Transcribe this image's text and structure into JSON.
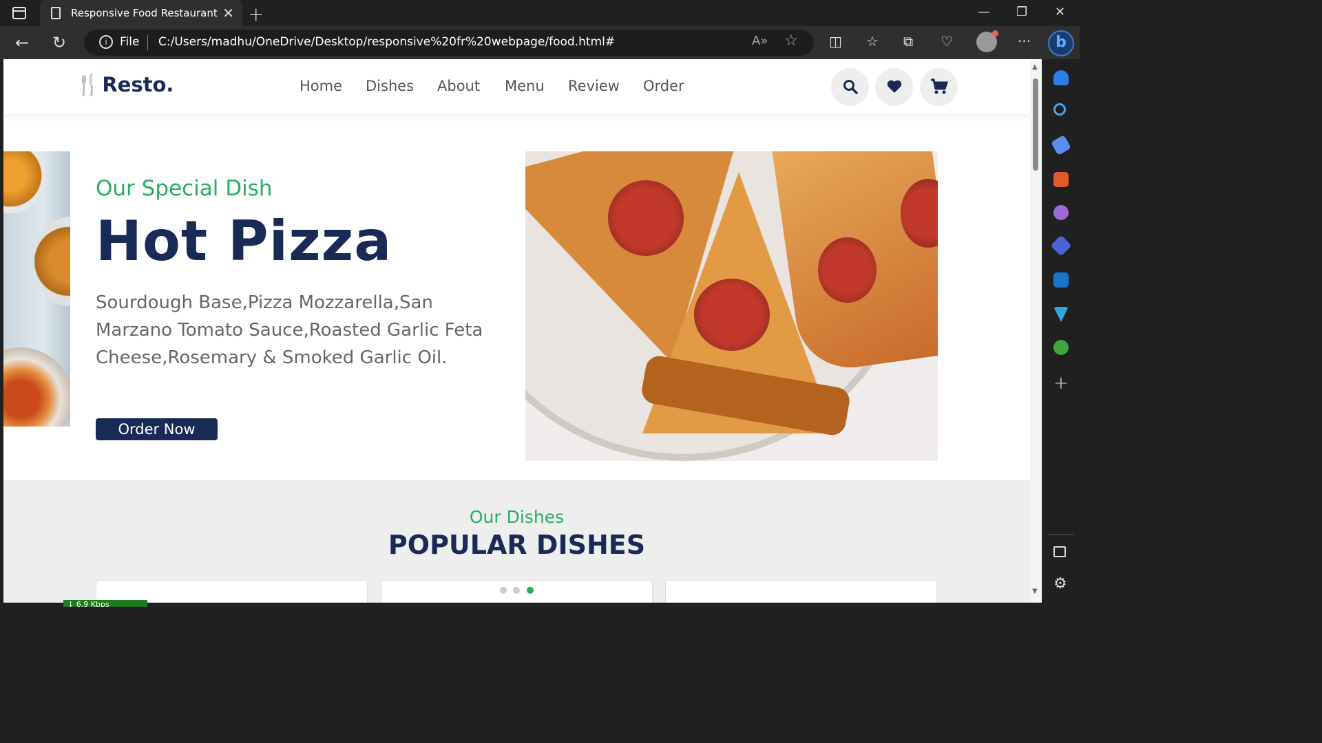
{
  "browser": {
    "tab_title": "Responsive Food Restaurant",
    "address_scheme": "File",
    "url": "C:/Users/madhu/OneDrive/Desktop/responsive%20fr%20webpage/food.html#"
  },
  "site": {
    "logo_text": "Resto.",
    "nav": [
      "Home",
      "Dishes",
      "About",
      "Menu",
      "Review",
      "Order"
    ],
    "header_icons": [
      "search-icon",
      "heart-icon",
      "cart-icon"
    ]
  },
  "hero": {
    "subtitle": "Our Special Dish",
    "title": "Hot Pizza",
    "description": "Sourdough Base,Pizza Mozzarella,San Marzano Tomato Sauce,Roasted Garlic Feta Cheese,Rosemary & Smoked Garlic Oil.",
    "cta": "Order Now"
  },
  "dishes": {
    "subtitle": "Our Dishes",
    "title": "POPULAR DISHES",
    "active_dot": 2
  },
  "status": {
    "speed": "↓ 6.9 Kbps"
  },
  "colors": {
    "brand_green": "#27ae60",
    "brand_navy": "#192a56"
  }
}
